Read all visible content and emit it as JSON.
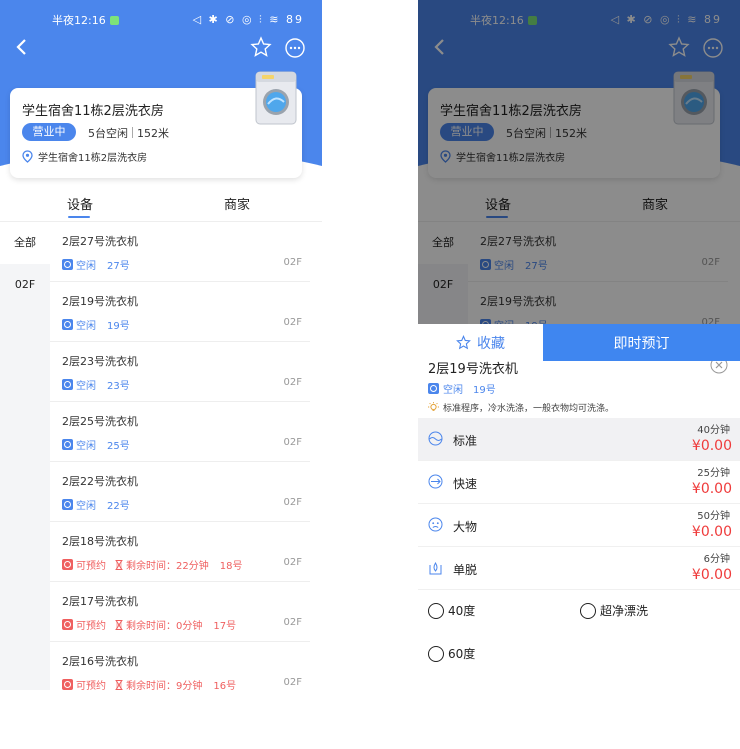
{
  "status_bar": {
    "time": "半夜12:16",
    "icons": "◁ ✱ ⊘ ◎ ⫶ ≋ 89"
  },
  "store": {
    "name": "学生宿舍11栋2层洗衣房",
    "open_badge": "营业中",
    "idle_count": "5台空闲",
    "distance": "152米",
    "address": "学生宿舍11栋2层洗衣房"
  },
  "tabs": [
    "设备",
    "商家"
  ],
  "sidebar": [
    "全部",
    "02F"
  ],
  "machines": [
    {
      "name": "2层27号洗衣机",
      "state": "空闲",
      "number": "27号",
      "remaining": "",
      "floor": "02F",
      "available": true
    },
    {
      "name": "2层19号洗衣机",
      "state": "空闲",
      "number": "19号",
      "remaining": "",
      "floor": "02F",
      "available": true
    },
    {
      "name": "2层23号洗衣机",
      "state": "空闲",
      "number": "23号",
      "remaining": "",
      "floor": "02F",
      "available": true
    },
    {
      "name": "2层25号洗衣机",
      "state": "空闲",
      "number": "25号",
      "remaining": "",
      "floor": "02F",
      "available": true
    },
    {
      "name": "2层22号洗衣机",
      "state": "空闲",
      "number": "22号",
      "remaining": "",
      "floor": "02F",
      "available": true
    },
    {
      "name": "2层18号洗衣机",
      "state": "可预约",
      "number": "18号",
      "remaining": "剩余时间：22分钟",
      "floor": "02F",
      "available": false
    },
    {
      "name": "2层17号洗衣机",
      "state": "可预约",
      "number": "17号",
      "remaining": "剩余时间：0分钟",
      "floor": "02F",
      "available": false
    },
    {
      "name": "2层16号洗衣机",
      "state": "可预约",
      "number": "16号",
      "remaining": "剩余时间：9分钟",
      "floor": "02F",
      "available": false
    }
  ],
  "detail_sheet": {
    "title": "2层19号洗衣机",
    "state": "空闲",
    "number": "19号",
    "description": "标准程序，冷水洗涤，一般衣物均可洗涤。",
    "programs": [
      {
        "name": "标准",
        "duration": "40分钟",
        "price": "¥0.00",
        "selected": true
      },
      {
        "name": "快速",
        "duration": "25分钟",
        "price": "¥0.00",
        "selected": false
      },
      {
        "name": "大物",
        "duration": "50分钟",
        "price": "¥0.00",
        "selected": false
      },
      {
        "name": "单脱",
        "duration": "6分钟",
        "price": "¥0.00",
        "selected": false
      }
    ],
    "options": [
      "40度",
      "超净漂洗",
      "60度"
    ],
    "favorite_label": "收藏",
    "book_label": "即时预订"
  },
  "colors": {
    "brand_blue": "#4b86ec",
    "busy_red": "#ef5f5f",
    "price_red": "#ef3b3b",
    "book_blue": "#3f86f0"
  }
}
